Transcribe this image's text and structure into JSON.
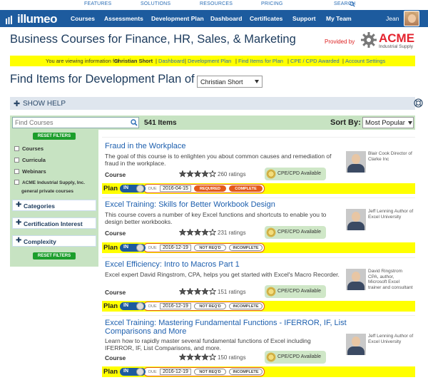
{
  "toplinks": [
    "FEATURES",
    "SOLUTIONS",
    "RESOURCES",
    "PRICING",
    "SEARCH"
  ],
  "logo": "illumeo",
  "nav": [
    "Courses",
    "Assessments",
    "Development Plan",
    "Dashboard",
    "Certificates",
    "Support",
    "My Team"
  ],
  "user": "Jean",
  "page_title": "Business Courses for Finance, HR, Sales, & Marketing",
  "provided_by": "Provided by",
  "acme": {
    "name": "ACME",
    "sub": "Industrial Supply"
  },
  "infobar": {
    "prefix": "You are viewing information for",
    "person": "Christian Short",
    "links": [
      "Dashboard",
      "Development Plan",
      "Find Items for Plan",
      "CPE / CPD Awarded",
      "Account Settings"
    ]
  },
  "find_title": "Find Items for Development Plan of",
  "selected_person": "Christian Short",
  "show_help": "SHOW HELP",
  "search": {
    "placeholder": "Find Courses"
  },
  "items_count": "541 Items",
  "sort_by": {
    "label": "Sort By:",
    "value": "Most Popular"
  },
  "sidebar": {
    "reset": "RESET FILTERS",
    "types": [
      "Courses",
      "Curricula",
      "Webinars",
      "ACME Industrial Supply, Inc."
    ],
    "types_sub": "general private courses",
    "facets": [
      "Categories",
      "Certification Interest",
      "Complexity"
    ]
  },
  "course_label": "Course",
  "cpe_label": "CPE/CPD Available",
  "plan_label": "Plan",
  "plan_in": "IN",
  "due_label": "DUE",
  "courses": [
    {
      "title": "Fraud in the Workplace",
      "desc": "The goal of this course is to enlighten you about common causes and remediation of fraud in the workplace.",
      "instructor": "Blair Cook Director of Clarke Inc",
      "rating": 4,
      "ratings": "260 ratings",
      "due": "2016-04-15",
      "status": [
        "REQUIRED",
        "COMPLETE"
      ]
    },
    {
      "title": "Excel Training: Skills for Better Workbook Design",
      "desc": "This course covers a number of key Excel functions and shortcuts to enable you to design better workbooks.",
      "instructor": "Jeff Lenning Author of Excel University",
      "rating": 4,
      "ratings": "231 ratings",
      "due": "2016-12-19",
      "status": [
        "NOT REQ'D",
        "INCOMPLETE"
      ]
    },
    {
      "title": "Excel Efficiency: Intro to Macros Part 1",
      "desc": "Excel expert David Ringstrom, CPA, helps you get started with Excel's Macro Recorder.",
      "instructor": "David Ringstrom CPA, author, Microsoft Excel trainer and consultant",
      "rating": 4,
      "ratings": "151 ratings",
      "due": "2016-12-19",
      "status": [
        "NOT REQ'D",
        "INCOMPLETE"
      ]
    },
    {
      "title": "Excel Training: Mastering Fundamental Functions - IFERROR, IF, List Comparisons and More",
      "desc": "Learn how to rapidly master several fundamental functions of Excel including IFERROR, IF, List Comparisons, and more.",
      "instructor": "Jeff Lenning Author of Excel University",
      "rating": 4,
      "ratings": "150 ratings",
      "due": "2016-12-19",
      "status": [
        "NOT REQ'D",
        "INCOMPLETE"
      ]
    }
  ]
}
